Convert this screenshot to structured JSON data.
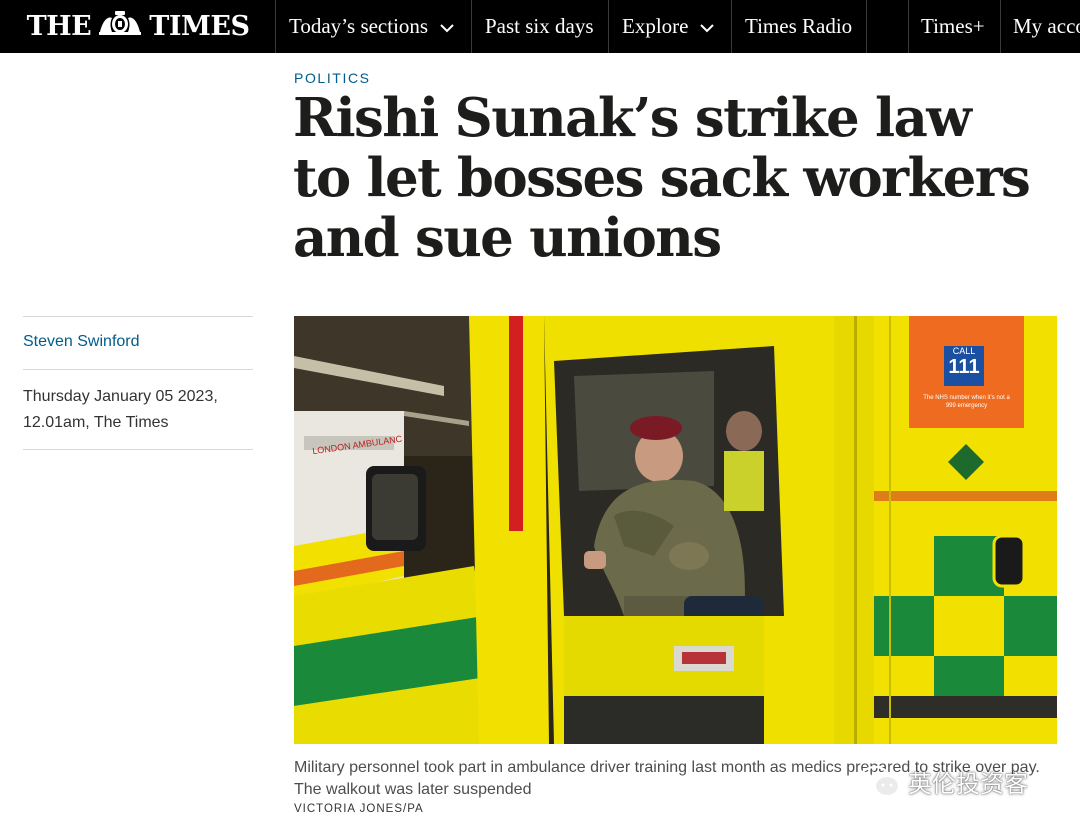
{
  "brand": {
    "logo_left": "THE",
    "logo_right": "TIMES"
  },
  "nav": {
    "items": [
      {
        "label": "Today’s sections",
        "has_dropdown": true
      },
      {
        "label": "Past six days",
        "has_dropdown": false
      },
      {
        "label": "Explore",
        "has_dropdown": true
      },
      {
        "label": "Times Radio",
        "has_dropdown": false
      },
      {
        "label": "Times+",
        "has_dropdown": false
      },
      {
        "label": "My acco",
        "has_dropdown": false
      }
    ]
  },
  "article": {
    "section": "POLITICS",
    "headline": "Rishi Sunak’s strike law to let bosses sack workers and sue unions",
    "author": "Steven Swinford",
    "date_line1": "Thursday January 05 2023,",
    "date_line2": "12.01am, The Times",
    "caption": "Military personnel took part in ambulance driver training last month as medics prepared to strike over pay. The walkout was later suspended",
    "credit": "VICTORIA JONES/PA"
  },
  "photo_text": {
    "call_label": "CALL",
    "call_number": "111",
    "call_note": "The NHS number when it’s not a 999 emergency",
    "ambulance_label": "LONDON AMBULANCE"
  },
  "watermark": {
    "text": "英伦投资客"
  },
  "colors": {
    "nav_bg": "#000000",
    "accent_blue": "#005c8a",
    "ambulance_yellow": "#f2e100",
    "ambulance_green": "#1a8a3a"
  }
}
